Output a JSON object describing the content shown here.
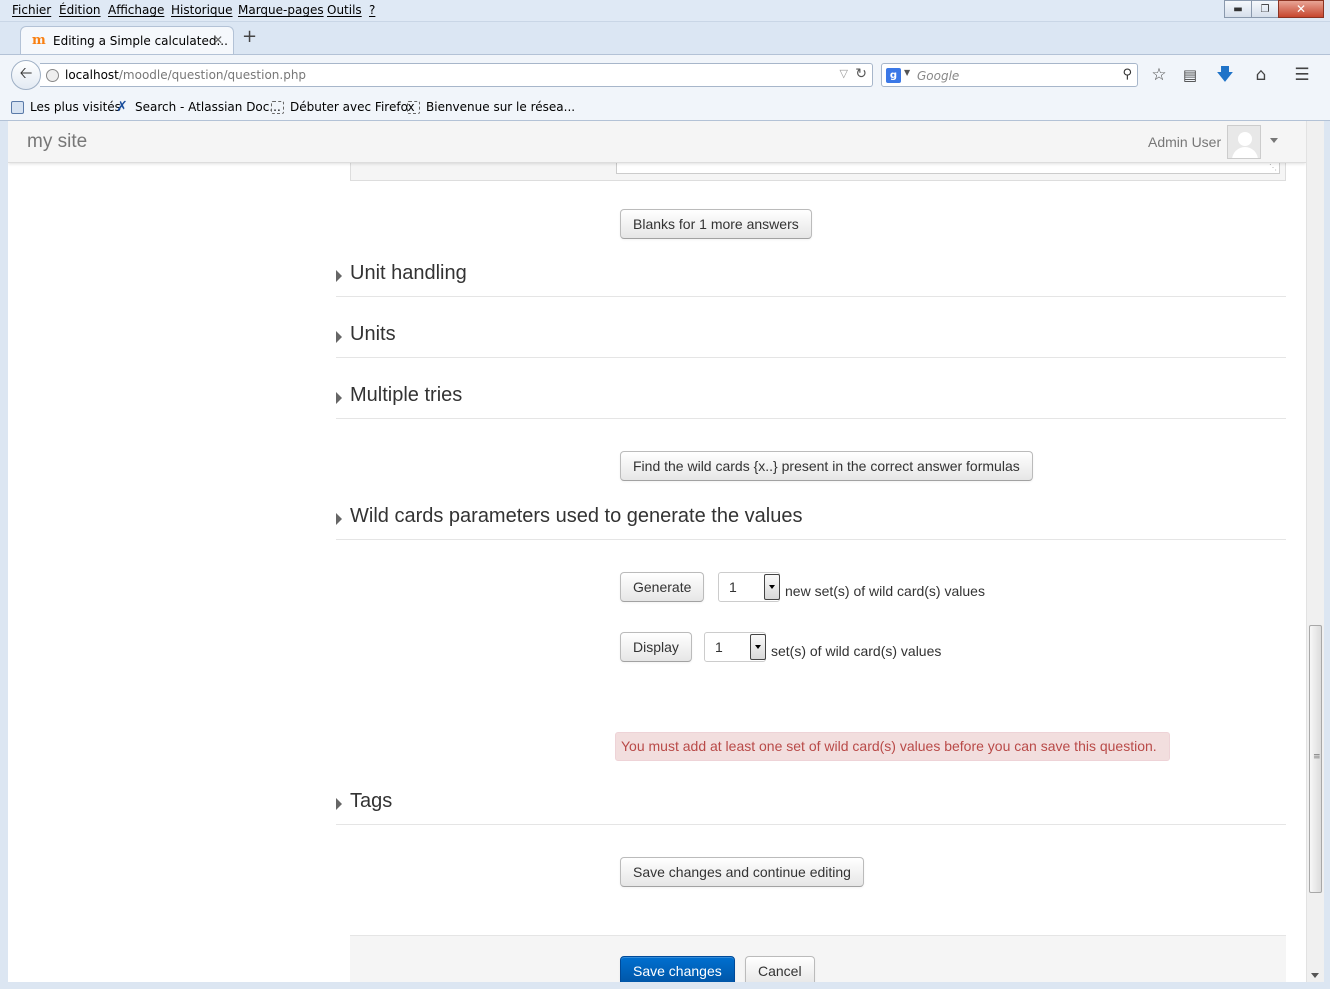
{
  "browser": {
    "menu": [
      "Fichier",
      "Édition",
      "Affichage",
      "Historique",
      "Marque-pages",
      "Outils",
      "?"
    ],
    "tab_title": "Editing a Simple calculated...",
    "url_host": "localhost",
    "url_path": "/moodle/question/question.php",
    "search_placeholder": "Google",
    "bookmarks": [
      "Les plus visités",
      "Search - Atlassian Doc...",
      "Débuter avec Firefox",
      "Bienvenue sur le résea..."
    ]
  },
  "header": {
    "site_name": "my site",
    "user_name": "Admin User"
  },
  "form": {
    "blanks_button": "Blanks for 1 more answers",
    "sections": {
      "unit_handling": "Unit handling",
      "units": "Units",
      "multiple_tries": "Multiple tries",
      "wildcards": "Wild cards parameters used to generate the values",
      "tags": "Tags"
    },
    "find_wildcards_button": "Find the wild cards {x..} present in the correct answer formulas",
    "generate_button": "Generate",
    "generate_value": "1",
    "generate_label": "new set(s) of wild card(s) values",
    "display_button": "Display",
    "display_value": "1",
    "display_label": "set(s) of wild card(s) values",
    "error_message": "You must add at least one set of wild card(s) values before you can save this question.",
    "save_continue_button": "Save changes and continue editing",
    "save_button": "Save changes",
    "cancel_button": "Cancel"
  }
}
